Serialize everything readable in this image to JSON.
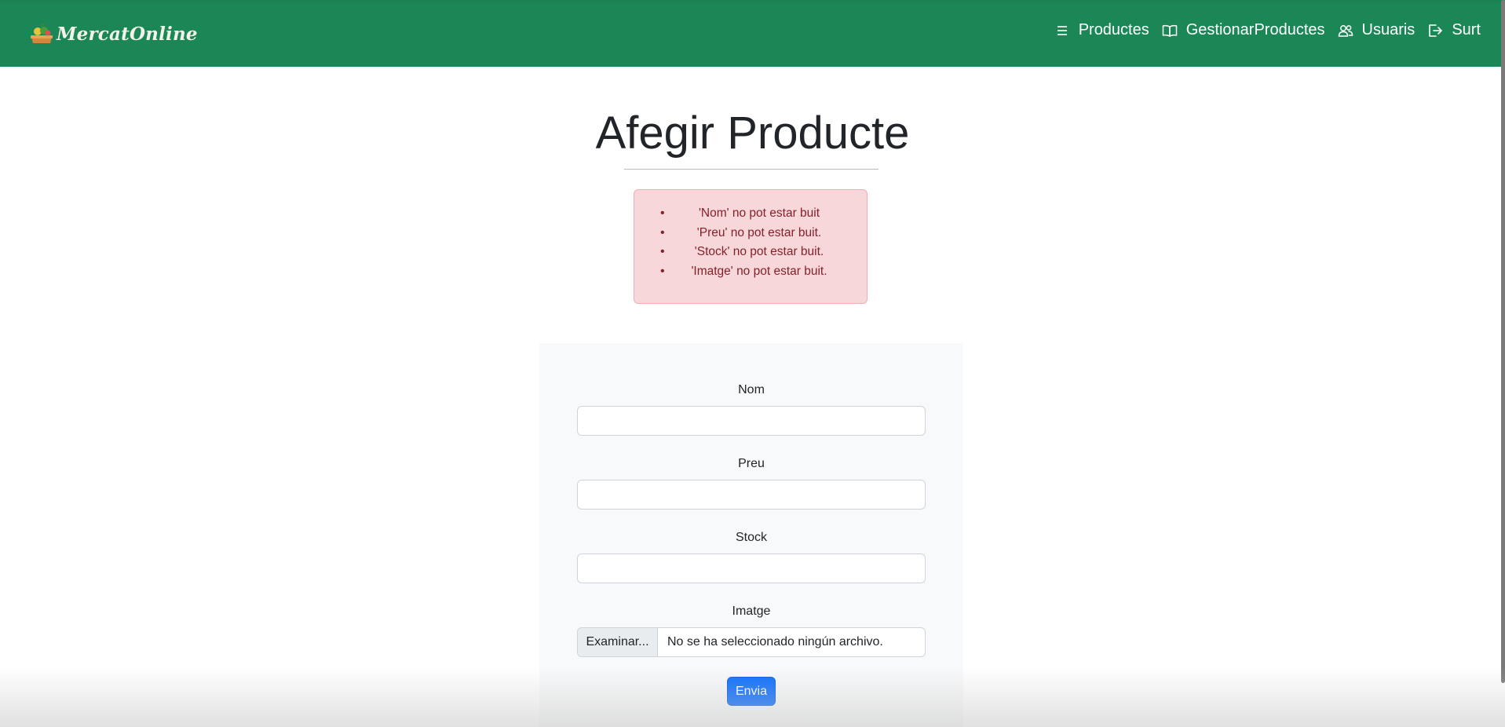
{
  "navbar": {
    "brand": "MercatOnline",
    "links": [
      {
        "label": "Productes",
        "icon": "list-icon"
      },
      {
        "label": "GestionarProductes",
        "icon": "book-icon"
      },
      {
        "label": "Usuaris",
        "icon": "users-icon"
      },
      {
        "label": "Surt",
        "icon": "logout-icon"
      }
    ]
  },
  "page": {
    "title": "Afegir Producte"
  },
  "alert": {
    "errors": [
      "'Nom' no pot estar buit",
      "'Preu' no pot estar buit.",
      "'Stock' no pot estar buit.",
      "'Imatge' no pot estar buit."
    ]
  },
  "form": {
    "fields": [
      {
        "label": "Nom",
        "value": ""
      },
      {
        "label": "Preu",
        "value": ""
      },
      {
        "label": "Stock",
        "value": ""
      }
    ],
    "image": {
      "label": "Imatge",
      "button": "Examinar...",
      "status": "No se ha seleccionado ningún archivo."
    },
    "submit": "Envia"
  },
  "colors": {
    "navbar": "#1b8756",
    "alert_bg": "#f8d7da",
    "alert_text": "#842029",
    "primary": "#0d6efd",
    "card_bg": "#f8f9fa"
  }
}
